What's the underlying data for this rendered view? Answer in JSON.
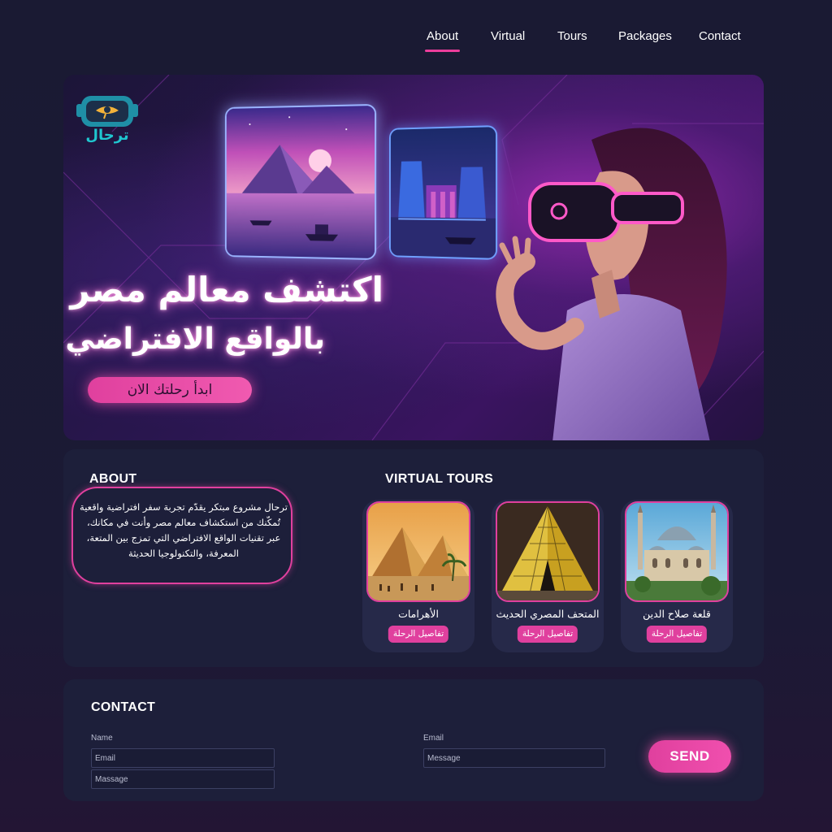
{
  "nav": {
    "items": [
      {
        "label": "About",
        "active": true
      },
      {
        "label": "Virtual",
        "active": false
      },
      {
        "label": "Tours",
        "active": false
      },
      {
        "label": "Packages",
        "active": false
      },
      {
        "label": "Contact",
        "active": false
      }
    ]
  },
  "hero": {
    "logo_text": "ترحال",
    "title_line_1": "اكتشف معالم مصر",
    "title_line_2": "بالواقع الافتراضي",
    "cta_label": "ابدأ رحلتك الان"
  },
  "about": {
    "heading": "ABOUT",
    "text": "ترحال مشروع مبتكر يقدّم تجربة سفر افتراضية واقعية تُمكّنك من استكشاف معالم مصر وأنت في مكانك، عبر تقنيات الواقع الافتراضي التي تمزج بين المتعة، المعرفة، والتكنولوجيا الحديثة"
  },
  "tours": {
    "heading": "VIRTUAL TOURS",
    "cards": [
      {
        "name": "الأهرامات",
        "button": "تفاصيل الرحلة"
      },
      {
        "name": "المتحف المصري الحديث",
        "button": "تفاصيل الرحلة"
      },
      {
        "name": "قلعة صلاح الدين",
        "button": "تفاصيل الرحلة"
      }
    ]
  },
  "contact": {
    "heading": "CONTACT",
    "name_label": "Name",
    "email_label": "Email",
    "name_email_placeholder": "Email",
    "name_message_placeholder": "Massage",
    "email_message_placeholder": "Message",
    "send_label": "SEND"
  },
  "colors": {
    "accent": "#e0409e",
    "background": "#1a1a33",
    "card": "#1d1f3a"
  }
}
